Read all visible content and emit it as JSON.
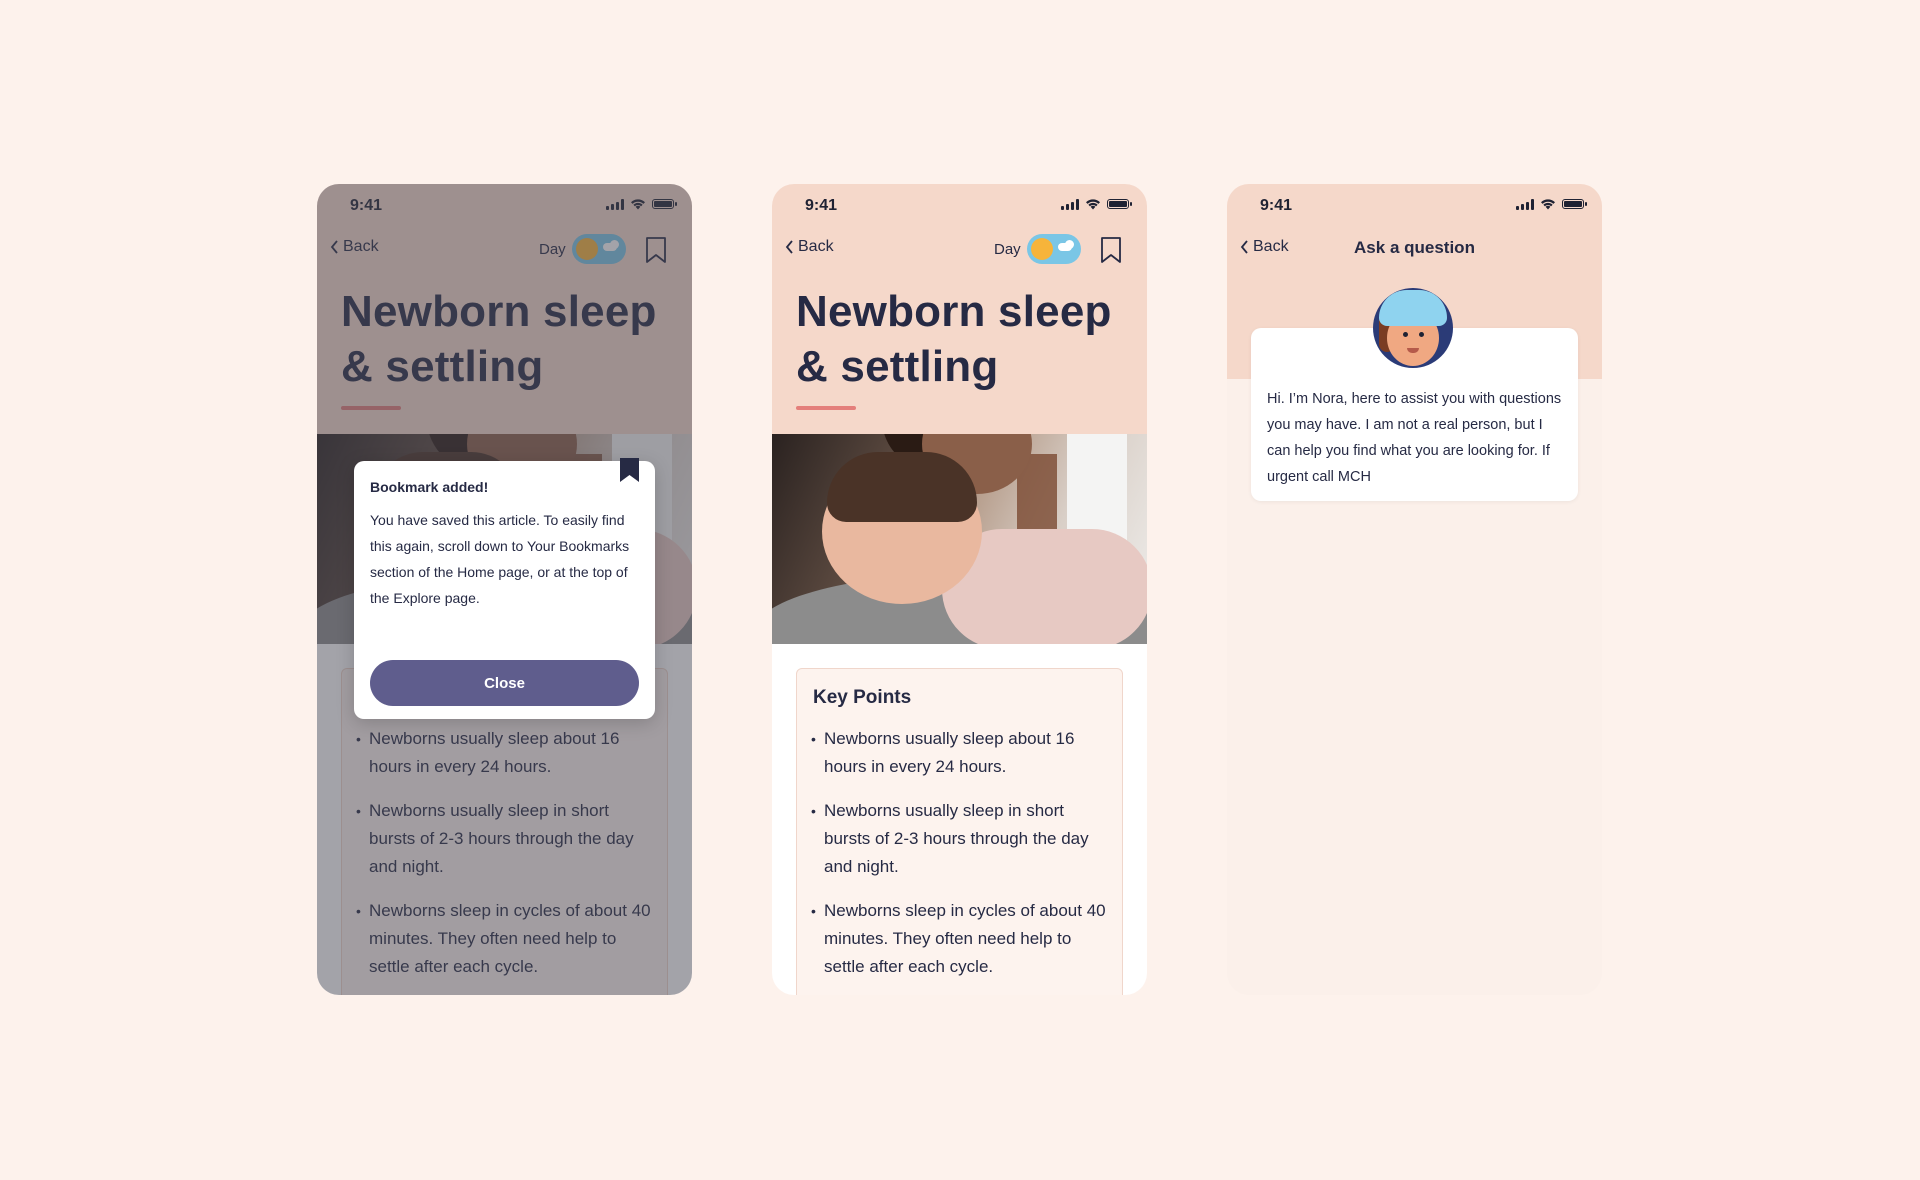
{
  "status_bar": {
    "time": "9:41"
  },
  "nav": {
    "back_label": "Back",
    "day_label": "Day"
  },
  "article": {
    "title": "Newborn sleep & settling",
    "key_points_title": "Key Points",
    "key_points": [
      "Newborns usually sleep about 16 hours in every 24 hours.",
      "Newborns usually sleep in short bursts of 2-3 hours through the day and night.",
      "Newborns sleep in cycles of about 40 minutes. They often need help to settle after each cycle."
    ]
  },
  "bookmark_modal": {
    "title": "Bookmark added!",
    "body": "You have saved this article. To easily find this again, scroll down to Your Bookmarks section of the Home page, or at the top of the Explore page.",
    "close_label": "Close"
  },
  "chat": {
    "title": "Ask a question",
    "message": "Hi. I’m Nora, here to assist you with questions you may have. I am not a real person, but I can help you find what you are looking for. If urgent call MCH"
  },
  "colors": {
    "page_bg": "#fdf2ec",
    "header_bg": "#f5d8ca",
    "accent": "#e47f7b",
    "button": "#5f5d8d",
    "text": "#262a44"
  }
}
